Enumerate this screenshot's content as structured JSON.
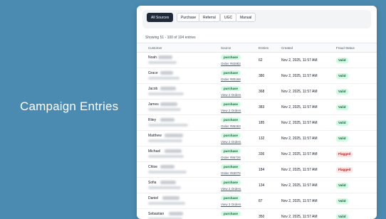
{
  "hero": {
    "title": "Campaign Entries"
  },
  "filters": {
    "tabs": [
      "All Sources",
      "Purchase",
      "Referral",
      "UGC",
      "Manual"
    ],
    "active": "All Sources"
  },
  "table": {
    "count_text": "Showing 51 - 100 of 104 entries",
    "headers": [
      "Customer",
      "Source",
      "Entries",
      "Created",
      "Fraud Status"
    ],
    "rows": [
      {
        "name": "Noah",
        "source": "purchase",
        "link": "Order #82983",
        "entries": "62",
        "created": "Nov 2, 2025, 11:57 AM",
        "status": "Valid"
      },
      {
        "name": "Grace",
        "source": "purchase",
        "link": "Order #80169",
        "entries": "380",
        "created": "Nov 2, 2025, 11:57 AM",
        "status": "Valid"
      },
      {
        "name": "Jacob",
        "source": "purchase",
        "link": "View 2 Orders",
        "entries": "368",
        "created": "Nov 2, 2025, 11:57 AM",
        "status": "Valid"
      },
      {
        "name": "James",
        "source": "purchase",
        "link": "View 2 Orders",
        "entries": "383",
        "created": "Nov 2, 2025, 11:57 AM",
        "status": "Valid"
      },
      {
        "name": "Riley",
        "source": "purchase",
        "link": "Order #85263",
        "entries": "185",
        "created": "Nov 2, 2025, 11:57 AM",
        "status": "Valid"
      },
      {
        "name": "Matthew",
        "source": "purchase",
        "link": "View 2 Orders",
        "entries": "132",
        "created": "Nov 2, 2025, 11:57 AM",
        "status": "Valid"
      },
      {
        "name": "Michael",
        "source": "purchase",
        "link": "Order #86726",
        "entries": "336",
        "created": "Nov 2, 2025, 11:57 AM",
        "status": "Flagged"
      },
      {
        "name": "Chloe",
        "source": "purchase",
        "link": "Order #83078",
        "entries": "184",
        "created": "Nov 2, 2025, 11:57 AM",
        "status": "Flagged"
      },
      {
        "name": "Sofia",
        "source": "purchase",
        "link": "View 2 Orders",
        "entries": "134",
        "created": "Nov 2, 2025, 11:57 AM",
        "status": "Valid"
      },
      {
        "name": "Daniel",
        "source": "purchase",
        "link": "View 3 Orders",
        "entries": "87",
        "created": "Nov 2, 2025, 11:57 AM",
        "status": "Valid"
      },
      {
        "name": "Sebastian",
        "source": "purchase",
        "link": "",
        "entries": "350",
        "created": "Nov 2, 2025, 11:57 AM",
        "status": "Valid"
      }
    ]
  },
  "colors": {
    "background": "#4b8ab1",
    "valid_bg": "#d1fae5",
    "flagged_bg": "#fee2e2"
  }
}
